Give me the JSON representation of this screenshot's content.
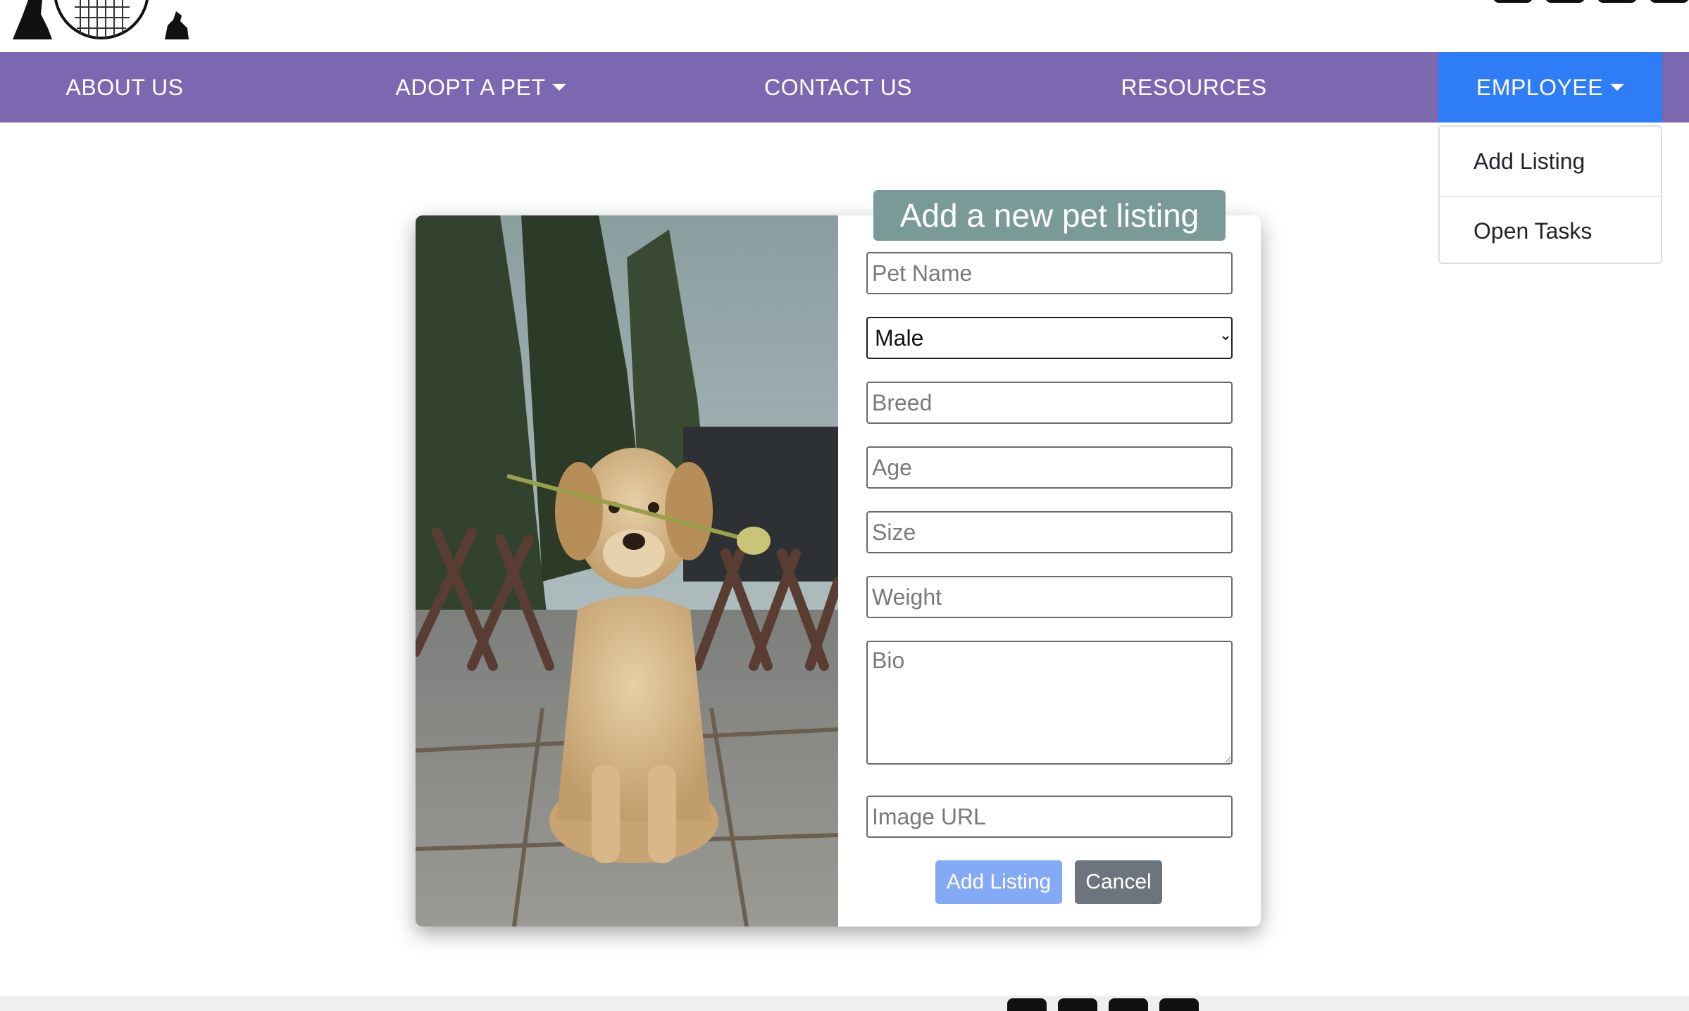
{
  "header": {
    "logo_icon": "pet-shelter-logo",
    "social_icons": [
      "social-icon-1",
      "social-icon-2",
      "social-icon-3",
      "social-icon-4"
    ]
  },
  "nav": {
    "about": "ABOUT US",
    "adopt": "ADOPT A PET",
    "contact": "CONTACT US",
    "resources": "RESOURCES",
    "employee": "EMPLOYEE"
  },
  "employee_menu": {
    "add_listing": "Add Listing",
    "open_tasks": "Open Tasks"
  },
  "form": {
    "title": "Add a new pet listing",
    "pet_name_placeholder": "Pet Name",
    "sex_value": "Male",
    "breed_placeholder": "Breed",
    "age_placeholder": "Age",
    "size_placeholder": "Size",
    "weight_placeholder": "Weight",
    "bio_placeholder": "Bio",
    "image_url_placeholder": "Image URL",
    "add_button": "Add Listing",
    "cancel_button": "Cancel"
  },
  "colors": {
    "nav_bg": "#7b68b0",
    "nav_active": "#2e7cf6",
    "title_bg": "#7a9a98",
    "add_button": "#84a9f5",
    "cancel_button": "#6c757d"
  }
}
